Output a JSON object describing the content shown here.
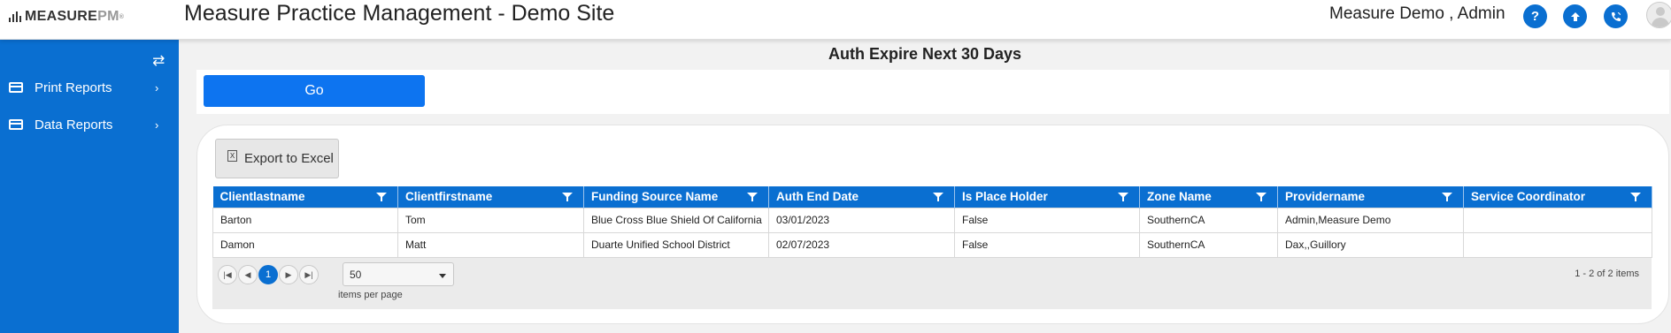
{
  "header": {
    "logo_text": "MEASURE",
    "logo_suffix": "PM",
    "logo_tm": "®",
    "title": "Measure Practice Management - Demo Site",
    "user": "Measure Demo , Admin",
    "icons": [
      "help-icon",
      "upload-icon",
      "phone-icon",
      "user-avatar-icon"
    ]
  },
  "sidebar": {
    "items": [
      {
        "label": "Print Reports"
      },
      {
        "label": "Data Reports"
      }
    ]
  },
  "main": {
    "title": "Auth Expire Next 30 Days",
    "go_label": "Go",
    "export_label": "Export to Excel",
    "columns": [
      "Clientlastname",
      "Clientfirstname",
      "Funding Source Name",
      "Auth End Date",
      "Is Place Holder",
      "Zone Name",
      "Providername",
      "Service Coordinator"
    ],
    "rows": [
      [
        "Barton",
        "Tom",
        "Blue Cross Blue Shield Of California",
        "03/01/2023",
        "False",
        "SouthernCA",
        "Admin,Measure Demo",
        ""
      ],
      [
        "Damon",
        "Matt",
        "Duarte Unified School District",
        "02/07/2023",
        "False",
        "SouthernCA",
        "Dax,,Guillory",
        ""
      ]
    ],
    "pager": {
      "current_page": "1",
      "page_size": "50",
      "page_size_label": "items per page",
      "info": "1 - 2 of 2 items"
    }
  },
  "colors": {
    "primary": "#0a6fd1",
    "go_button": "#0d74f0",
    "background": "#f2f2f2"
  }
}
